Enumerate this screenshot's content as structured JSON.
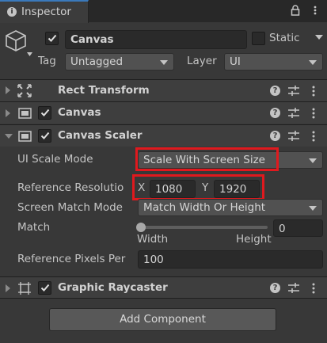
{
  "tab": {
    "title": "Inspector",
    "icon": "info-icon"
  },
  "header": {
    "object_name": "Canvas",
    "static_label": "Static",
    "tag_label": "Tag",
    "tag_value": "Untagged",
    "layer_label": "Layer",
    "layer_value": "UI",
    "active": true,
    "static": false
  },
  "components": {
    "rect_transform": {
      "title": "Rect Transform",
      "expanded": false
    },
    "canvas": {
      "title": "Canvas",
      "enabled": true,
      "expanded": false
    },
    "canvas_scaler": {
      "title": "Canvas Scaler",
      "enabled": true,
      "expanded": true,
      "ui_scale_mode_label": "UI Scale Mode",
      "ui_scale_mode_value": "Scale With Screen Size",
      "reference_resolution_label": "Reference Resolutio",
      "x_label": "X",
      "x_value": "1080",
      "y_label": "Y",
      "y_value": "1920",
      "screen_match_mode_label": "Screen Match Mode",
      "screen_match_mode_value": "Match Width Or Height",
      "match_label": "Match",
      "match_value": "0",
      "match_fraction": 0,
      "match_min_label": "Width",
      "match_max_label": "Height",
      "reference_pixels_label": "Reference Pixels Per",
      "reference_pixels_value": "100"
    },
    "graphic_raycaster": {
      "title": "Graphic Raycaster",
      "enabled": true,
      "expanded": false
    }
  },
  "add_component_label": "Add Component",
  "colors": {
    "background": "#383838",
    "highlight": "#e0191e",
    "tab_accent": "#3a79bb"
  }
}
